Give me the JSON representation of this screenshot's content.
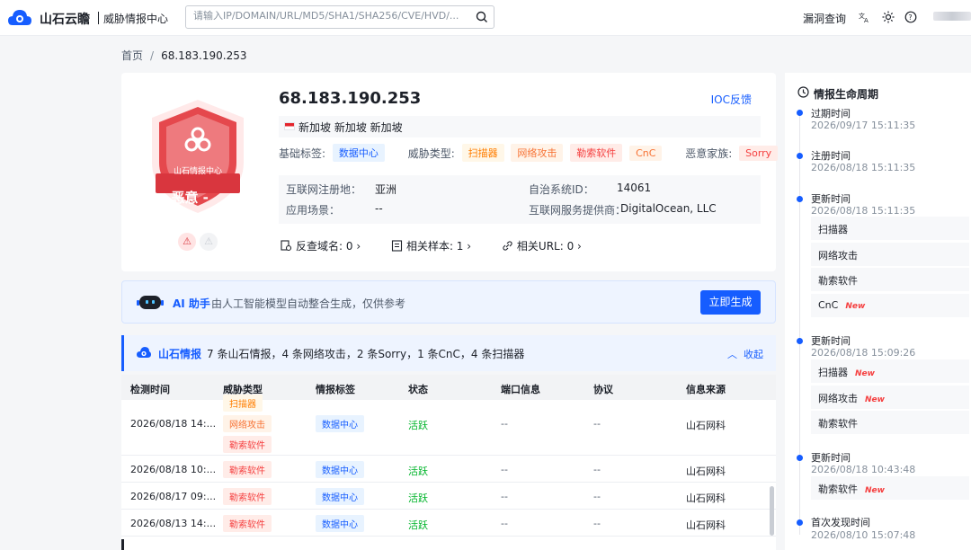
{
  "header": {
    "brand": "山石云瞻",
    "subtitle": "威胁情报中心",
    "search_placeholder": "请输入IP/DOMAIN/URL/MD5/SHA1/SHA256/CVE/HVD/...",
    "vuln_link": "漏洞查询"
  },
  "breadcrumb": {
    "home": "首页",
    "separator": "/",
    "current": "68.183.190.253"
  },
  "ioc": {
    "ip": "68.183.190.253",
    "feedback": "IOC反馈",
    "location": "新加坡 新加坡 新加坡",
    "badge_org": "山石情报中心",
    "verdict": "- 恶意 -",
    "basic_tags_label": "基础标签:",
    "basic_tags": [
      "数据中心"
    ],
    "threat_types_label": "威胁类型:",
    "threat_types": [
      "扫描器",
      "网络攻击",
      "勒索软件",
      "CnC"
    ],
    "family_label": "恶意家族:",
    "families": [
      "Sorry"
    ],
    "registry_label": "互联网注册地：",
    "registry_value": "亚洲",
    "asn_label": "自治系统ID：",
    "asn_value": "14061",
    "scene_label": "应用场景：",
    "scene_value": "--",
    "isp_label": "互联网服务提供商：",
    "isp_value": "DigitalOcean, LLC",
    "reverse_domain": "反查域名: 0",
    "related_samples": "相关样本: 1",
    "related_urls": "相关URL: 0"
  },
  "ai": {
    "title": "AI 助手",
    "desc": "由人工智能模型自动整合生成，仅供参考",
    "button": "立即生成"
  },
  "intel": {
    "title": "山石情报",
    "summary": "7 条山石情报，4 条网络攻击，2 条Sorry，1 条CnC，4 条扫描器",
    "collapse": "收起",
    "columns": [
      "检测时间",
      "威胁类型",
      "情报标签",
      "状态",
      "端口信息",
      "协议",
      "信息来源"
    ],
    "rows": [
      {
        "time": "2026/08/18 14:...",
        "threats": [
          "扫描器",
          "网络攻击",
          "勒索软件"
        ],
        "tag": "数据中心",
        "status": "活跃",
        "port": "--",
        "proto": "--",
        "source": "山石网科"
      },
      {
        "time": "2026/08/18 10:...",
        "threats": [
          "勒索软件"
        ],
        "tag": "数据中心",
        "status": "活跃",
        "port": "--",
        "proto": "--",
        "source": "山石网科"
      },
      {
        "time": "2026/08/17 09:...",
        "threats": [
          "勒索软件"
        ],
        "tag": "数据中心",
        "status": "活跃",
        "port": "--",
        "proto": "--",
        "source": "山石网科"
      },
      {
        "time": "2026/08/13 14:...",
        "threats": [
          "勒索软件"
        ],
        "tag": "数据中心",
        "status": "活跃",
        "port": "--",
        "proto": "--",
        "source": "山石网科"
      }
    ]
  },
  "lifecycle": {
    "title": "情报生命周期",
    "events": [
      {
        "label": "过期时间",
        "time": "2026/09/17 15:11:35",
        "items": []
      },
      {
        "label": "注册时间",
        "time": "2026/08/18 15:11:35",
        "items": []
      },
      {
        "label": "更新时间",
        "time": "2026/08/18 15:11:35",
        "items": [
          {
            "text": "扫描器",
            "new": false
          },
          {
            "text": "网络攻击",
            "new": false
          },
          {
            "text": "勒索软件",
            "new": false
          },
          {
            "text": "CnC",
            "new": true
          }
        ]
      },
      {
        "label": "更新时间",
        "time": "2026/08/18 15:09:26",
        "items": [
          {
            "text": "扫描器",
            "new": true
          },
          {
            "text": "网络攻击",
            "new": true
          },
          {
            "text": "勒索软件",
            "new": false
          }
        ]
      },
      {
        "label": "更新时间",
        "time": "2026/08/18 10:43:48",
        "items": [
          {
            "text": "勒索软件",
            "new": true
          }
        ]
      },
      {
        "label": "首次发现时间",
        "time": "2026/08/10 15:07:48",
        "items": []
      }
    ],
    "new_label": "New"
  },
  "colors": {
    "accent": "#165dff",
    "danger": "#d9363e",
    "active": "#00b42a"
  }
}
